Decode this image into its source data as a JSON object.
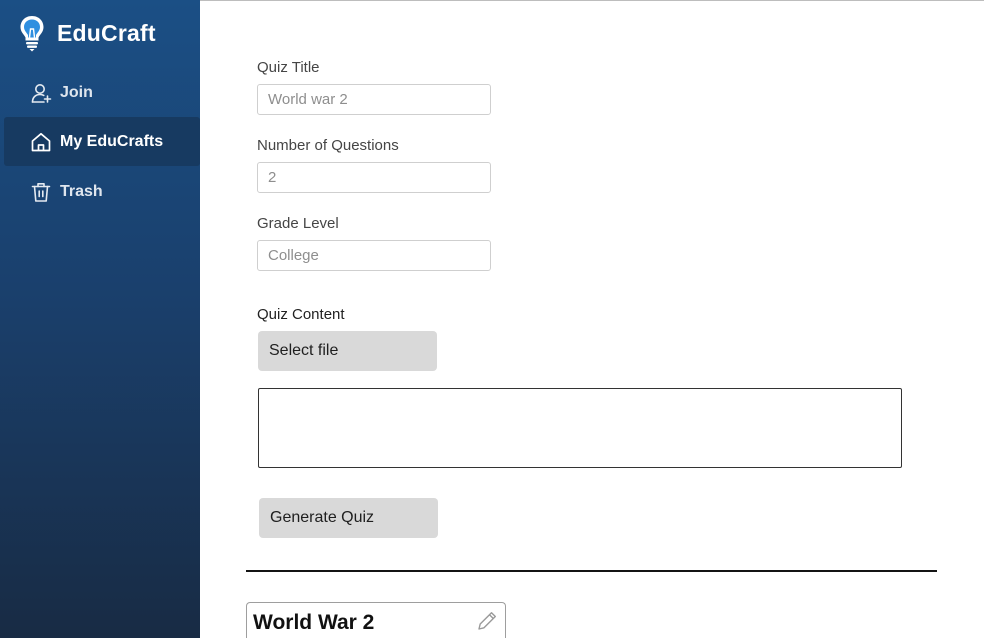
{
  "app": {
    "name": "EduCraft"
  },
  "sidebar": {
    "items": [
      {
        "label": "Join",
        "icon": "user-plus-icon"
      },
      {
        "label": "My EduCrafts",
        "icon": "home-icon",
        "active": true
      },
      {
        "label": "Trash",
        "icon": "trash-icon"
      }
    ]
  },
  "form": {
    "quiz_title": {
      "label": "Quiz Title",
      "value": "World war 2"
    },
    "num_questions": {
      "label": "Number of Questions",
      "value": "2"
    },
    "grade_level": {
      "label": "Grade Level",
      "value": "College"
    },
    "quiz_content": {
      "label": "Quiz Content",
      "value": ""
    },
    "select_file_label": "Select file",
    "generate_label": "Generate Quiz"
  },
  "quiz_card": {
    "title": "World War 2",
    "edit_icon": "pencil-icon"
  },
  "colors": {
    "sidebar_top": "#1b4f85",
    "sidebar_bottom": "#182b44",
    "button_bg": "#d9d9d9",
    "active_item": "#173a61"
  }
}
